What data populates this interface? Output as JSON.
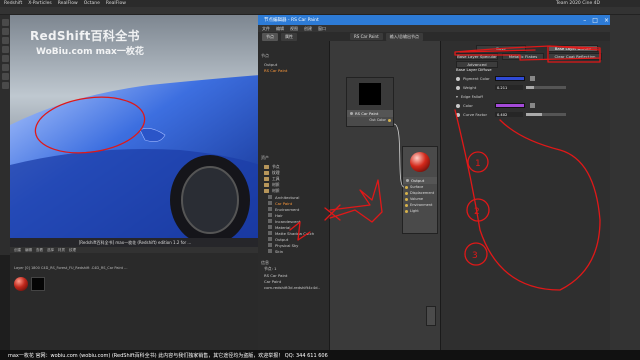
{
  "menubar": {
    "items": [
      "Redshift",
      "X-Particles",
      "RealFlow",
      "Octane",
      "RealFlow"
    ],
    "right_title": "Team 2020 Cine 4D"
  },
  "watermark": {
    "line1": "RedShift百科全书",
    "line2": "WoBiu.com  max一枚花"
  },
  "viewport": {
    "status": "[Redshift百科全书]     max一枚花 (Redshift)     edition 1.2 for     ..."
  },
  "node_editor": {
    "title": "节点编辑器  -  RS Car Paint",
    "menu": [
      "文件",
      "编辑",
      "视图",
      "创建",
      "窗口"
    ],
    "tabs": [
      {
        "label": "节点",
        "active": true
      },
      {
        "label": "属性",
        "active": false
      },
      {
        "label": "RS Car Paint",
        "active": false
      },
      {
        "label": "输入/总输出节点",
        "active": false
      }
    ],
    "sections": {
      "nodes": "节点",
      "assets": "资产",
      "info": "信息"
    },
    "node_list": [
      {
        "label": "Output",
        "selected": false
      },
      {
        "label": "RS Car Paint",
        "selected": true
      }
    ],
    "asset_tree": [
      {
        "label": "节点",
        "kind": "folder"
      },
      {
        "label": "纹理",
        "kind": "folder"
      },
      {
        "label": "工具",
        "kind": "folder"
      },
      {
        "label": "材质",
        "kind": "folder"
      },
      {
        "label": "材质",
        "kind": "folder"
      },
      {
        "label": "Architectural",
        "kind": "item",
        "selected": false
      },
      {
        "label": "Car Paint",
        "kind": "item",
        "selected": true
      },
      {
        "label": "Environment",
        "kind": "item",
        "selected": false
      },
      {
        "label": "Hair",
        "kind": "item",
        "selected": false
      },
      {
        "label": "Incandescent",
        "kind": "item",
        "selected": false
      },
      {
        "label": "Material",
        "kind": "item",
        "selected": false
      },
      {
        "label": "Matte Shadow Catch",
        "kind": "item",
        "selected": false
      },
      {
        "label": "Output",
        "kind": "item",
        "selected": false
      },
      {
        "label": "Physical Sky",
        "kind": "item",
        "selected": false
      },
      {
        "label": "Skin",
        "kind": "item",
        "selected": false
      }
    ],
    "info_rows": [
      "节点: 1",
      "RS Car Paint",
      "Car Paint",
      "com.redshift3d.redshift4c4d.."
    ],
    "graph": {
      "carpaint_node": {
        "title": "RS Car Paint",
        "out_port": "Out Color"
      },
      "output_node": {
        "title": "Output",
        "ports": [
          "Surface",
          "Displacement",
          "Volume",
          "Environment",
          "Light"
        ]
      }
    },
    "properties": {
      "tabs": [
        {
          "label": "Base",
          "active": false
        },
        {
          "label": "Base Layer Diffuse",
          "active": true
        },
        {
          "label": "Base Layer Specular",
          "active": false
        },
        {
          "label": "Metallic Flakes",
          "active": false
        },
        {
          "label": "Clear Coat Reflection",
          "active": false
        },
        {
          "label": "Advanced",
          "active": false
        }
      ],
      "section_title": "Base Layer Diffuse",
      "pigment_color_label": "Pigment Color",
      "pigment_color": "#2f4ad6",
      "weight_label": "Weight",
      "weight_value": "0.211",
      "weight_fraction": 0.211,
      "edge_falloff_label": "Edge Falloff",
      "color_label": "Color",
      "edge_color": "#a44ad8",
      "curve_factor_label": "Curve Factor",
      "curve_factor_value": "0.402",
      "curve_factor_fraction": 0.402
    }
  },
  "material_manager": {
    "menu": [
      "创建",
      "编辑",
      "查看",
      "选择",
      "材质",
      "纹理"
    ],
    "path": "Layer  [0] 1800 C4D_RS_Forest_FU_Redshift .C4D_RS_Car Paint ..."
  },
  "annotations": {
    "numbers": [
      "1",
      "2",
      "3"
    ],
    "text": "+"
  },
  "footer": {
    "text": "max一枚花 官网：wobiu.com (wobiu.com) (RedShift百科全书) 此内容与我们独家销售，其它途径均为盗版，欢迎举报！ QQ: 344 611 606",
    "status_left": "Redshift Warning: Object..."
  },
  "colors": {
    "titlebar_blue": "#2d7bd6",
    "annotation_red": "#e01818",
    "selection_orange": "#ff9a3c"
  }
}
